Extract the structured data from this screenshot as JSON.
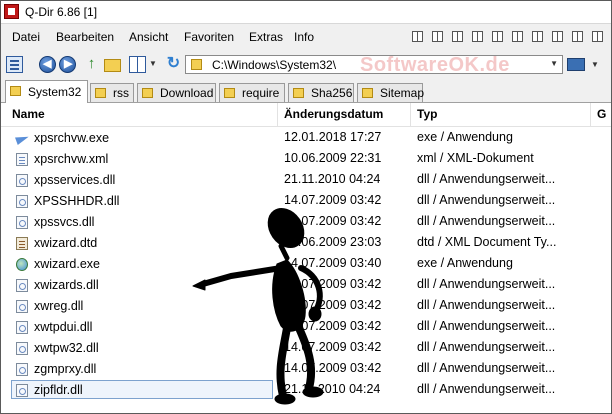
{
  "window": {
    "title": "Q-Dir 6.86 [1]"
  },
  "menu": {
    "items": [
      "Datei",
      "Bearbeiten",
      "Ansicht",
      "Favoriten",
      "Extras",
      "Info"
    ]
  },
  "toolbar": {
    "address": "C:\\Windows\\System32\\",
    "watermark": "SoftwareOK.de",
    "icons": [
      "view-icon",
      "back-icon",
      "forward-icon",
      "up-icon",
      "folder-icon",
      "grid-view-icon",
      "refresh-icon",
      "monitor-icon"
    ]
  },
  "tabs": [
    {
      "label": "System32",
      "active": true
    },
    {
      "label": "rss",
      "active": false
    },
    {
      "label": "Download",
      "active": false
    },
    {
      "label": "require",
      "active": false
    },
    {
      "label": "Sha256",
      "active": false
    },
    {
      "label": "Sitemap",
      "active": false
    }
  ],
  "list": {
    "columns": [
      "Name",
      "Änderungsdatum",
      "Typ",
      "G"
    ],
    "rows": [
      {
        "name": "xpsrchvw.exe",
        "date": "12.01.2018 17:27",
        "type": "exe / Anwendung",
        "icon": "exe-arrow"
      },
      {
        "name": "xpsrchvw.xml",
        "date": "10.06.2009 22:31",
        "type": "xml / XML-Dokument",
        "icon": "xml"
      },
      {
        "name": "xpsservices.dll",
        "date": "21.11.2010 04:24",
        "type": "dll / Anwendungserweit...",
        "icon": "dll"
      },
      {
        "name": "XPSSHHDR.dll",
        "date": "14.07.2009 03:42",
        "type": "dll / Anwendungserweit...",
        "icon": "dll"
      },
      {
        "name": "xpssvcs.dll",
        "date": "14.07.2009 03:42",
        "type": "dll / Anwendungserweit...",
        "icon": "dll"
      },
      {
        "name": "xwizard.dtd",
        "date": "10.06.2009 23:03",
        "type": "dtd / XML Document Ty...",
        "icon": "dtd"
      },
      {
        "name": "xwizard.exe",
        "date": "14.07.2009 03:40",
        "type": "exe / Anwendung",
        "icon": "exe-wizard"
      },
      {
        "name": "xwizards.dll",
        "date": "14.07.2009 03:42",
        "type": "dll / Anwendungserweit...",
        "icon": "dll"
      },
      {
        "name": "xwreg.dll",
        "date": "14.07.2009 03:42",
        "type": "dll / Anwendungserweit...",
        "icon": "dll"
      },
      {
        "name": "xwtpdui.dll",
        "date": "14.07.2009 03:42",
        "type": "dll / Anwendungserweit...",
        "icon": "dll"
      },
      {
        "name": "xwtpw32.dll",
        "date": "14.07.2009 03:42",
        "type": "dll / Anwendungserweit...",
        "icon": "dll"
      },
      {
        "name": "zgmprxy.dll",
        "date": "14.07.2009 03:42",
        "type": "dll / Anwendungserweit...",
        "icon": "dll"
      },
      {
        "name": "zipfldr.dll",
        "date": "21.11.2010 04:24",
        "type": "dll / Anwendungserweit...",
        "icon": "dll",
        "selected": true
      }
    ]
  },
  "overlay": {
    "figure": "pointing-stick-figure"
  }
}
